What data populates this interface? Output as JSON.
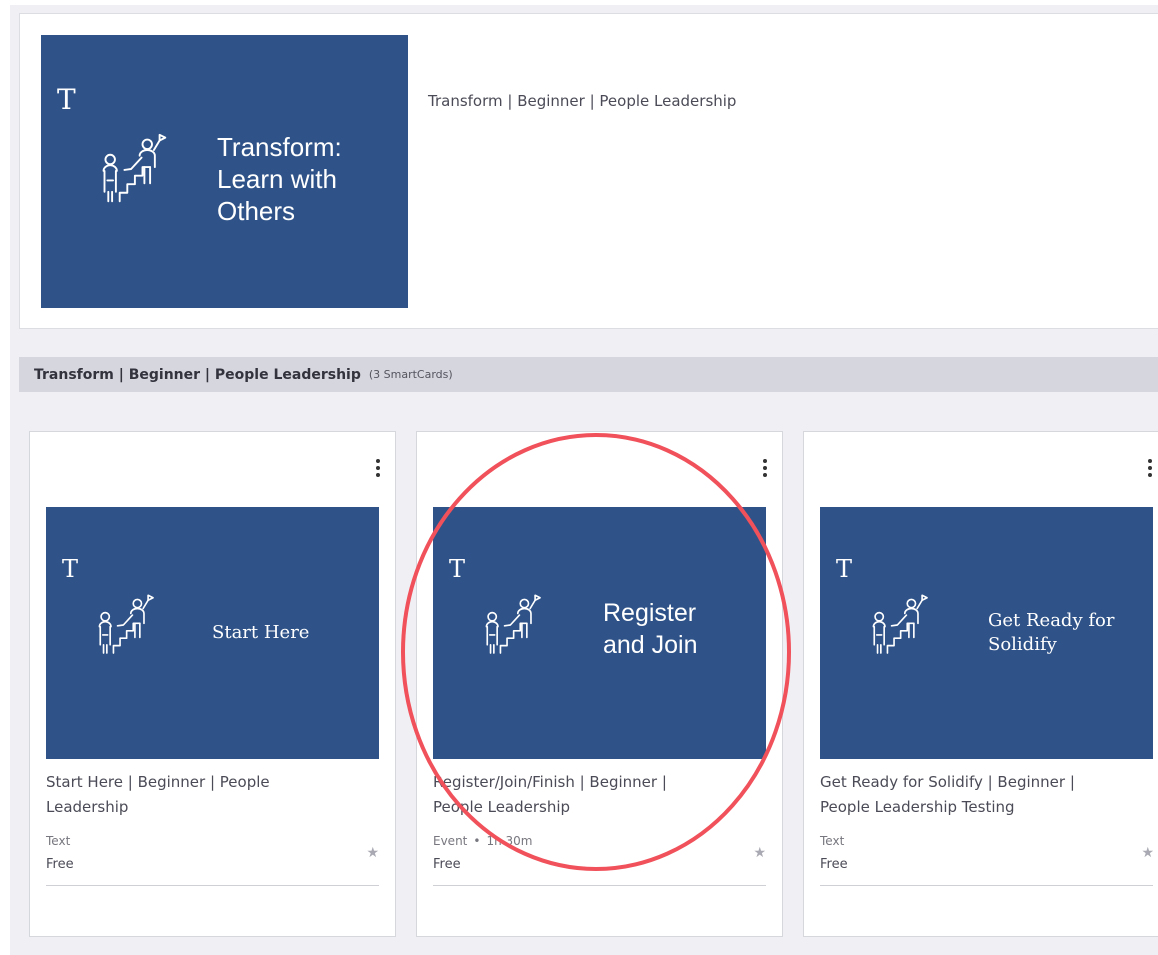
{
  "hero": {
    "banner_letter": "T",
    "banner_title_lines": [
      "Transform:",
      "Learn with",
      "Others"
    ],
    "meta": "Transform | Beginner | People Leadership"
  },
  "section": {
    "title": "Transform | Beginner | People Leadership",
    "count": "(3 SmartCards)"
  },
  "cards": [
    {
      "banner_letter": "T",
      "banner_title_lines": [
        "Start Here"
      ],
      "title_lines": [
        "Start Here | Beginner | People",
        "Leadership"
      ],
      "type": "Text",
      "duration": "",
      "price": "Free"
    },
    {
      "banner_letter": "T",
      "banner_title_lines": [
        "Register",
        "and Join"
      ],
      "title_lines": [
        "Register/Join/Finish | Beginner |",
        "People Leadership"
      ],
      "type": "Event",
      "duration": "1h 30m",
      "price": "Free"
    },
    {
      "banner_letter": "T",
      "banner_title_lines": [
        "Get Ready for",
        "Solidify"
      ],
      "title_lines": [
        "Get Ready for Solidify | Beginner |",
        "People Leadership Testing"
      ],
      "type": "Text",
      "duration": "",
      "price": "Free"
    }
  ],
  "colors": {
    "banner": "#2f5388",
    "highlight": "#f0515a"
  },
  "icons": {
    "figure": "climbing-stairs-icon",
    "menu": "kebab-menu-icon",
    "star": "star-icon"
  }
}
